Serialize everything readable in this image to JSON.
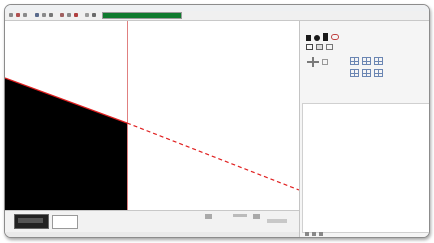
{
  "window": {
    "title": ""
  },
  "toolbar": {
    "progress_value": 1.0
  },
  "panel": {
    "title": ""
  },
  "layers": {
    "header": "",
    "rows": [
      {
        "label": ""
      }
    ]
  },
  "bottom": {
    "labels": []
  },
  "status": {
    "text": ""
  },
  "colors": {
    "progress": "#0f7a2e",
    "divider_line": "#e06060",
    "diagonal_line": "#e02020",
    "fill_shape": "#000000",
    "panel_icons": "#6b86b3"
  },
  "icons": [
    "app-icon",
    "undo-icon",
    "redo-icon",
    "select-icon",
    "hand-icon",
    "pencil-icon",
    "rectangle-icon",
    "ellipse-icon",
    "fill-icon",
    "polygon-icon",
    "bezier-icon",
    "grid-icon",
    "snap-icon",
    "layers-icon"
  ]
}
